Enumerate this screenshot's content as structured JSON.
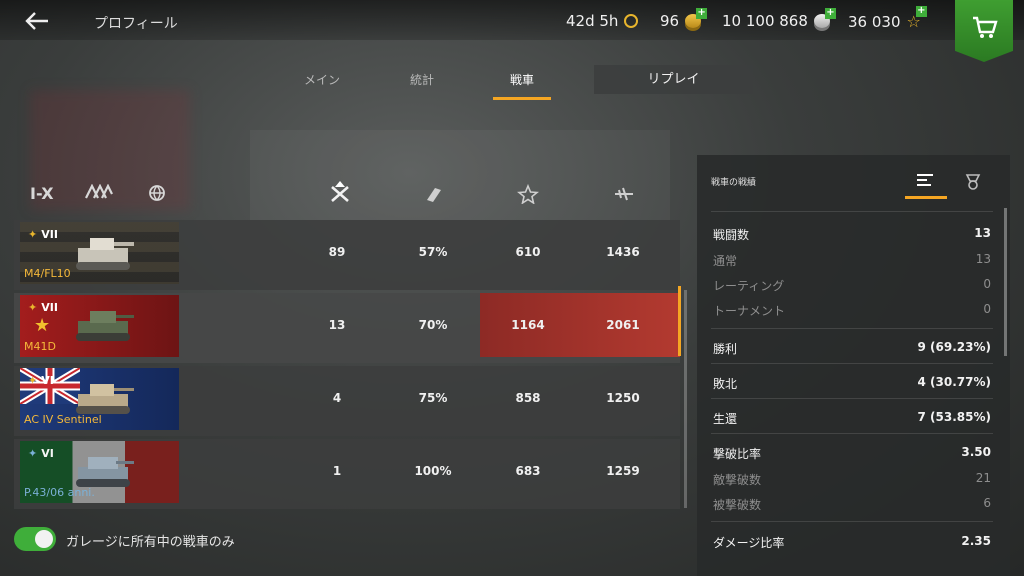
{
  "header": {
    "title": "プロフィール",
    "premium_time": "42d 5h",
    "gold": "96",
    "credits": "10 100 868",
    "free_xp": "36 030"
  },
  "tabs": [
    {
      "label": "メイン",
      "active": false
    },
    {
      "label": "統計",
      "active": false
    },
    {
      "label": "戦車",
      "active": true
    }
  ],
  "replay_button": "リプレイ",
  "filters": {
    "tier": "I-X"
  },
  "tanks": [
    {
      "tier": "VII",
      "name": "M4/FL10",
      "battles": "89",
      "winrate": "57%",
      "avg_xp": "610",
      "avg_damage": "1436",
      "flag": "france",
      "selected": false
    },
    {
      "tier": "VII",
      "name": "M41D",
      "battles": "13",
      "winrate": "70%",
      "avg_xp": "1164",
      "avg_damage": "2061",
      "flag": "china",
      "selected": true
    },
    {
      "tier": "VI",
      "name": "AC IV Sentinel",
      "battles": "4",
      "winrate": "75%",
      "avg_xp": "858",
      "avg_damage": "1250",
      "flag": "uk",
      "selected": false
    },
    {
      "tier": "VI",
      "name": "P.43/06 anni.",
      "battles": "1",
      "winrate": "100%",
      "avg_xp": "683",
      "avg_damage": "1259",
      "flag": "italy",
      "selected": false
    }
  ],
  "toggle": {
    "label": "ガレージに所有中の戦車のみ",
    "on": true
  },
  "panel": {
    "title": "戦車の戦績",
    "stats": [
      {
        "label": "戦闘数",
        "value": "13",
        "type": "main"
      },
      {
        "label": "通常",
        "value": "13",
        "type": "sub"
      },
      {
        "label": "レーティング",
        "value": "0",
        "type": "sub"
      },
      {
        "label": "トーナメント",
        "value": "0",
        "type": "sub"
      },
      {
        "label": "勝利",
        "value": "9 (69.23%)",
        "type": "main"
      },
      {
        "label": "敗北",
        "value": "4 (30.77%)",
        "type": "main"
      },
      {
        "label": "生還",
        "value": "7 (53.85%)",
        "type": "main"
      },
      {
        "label": "撃破比率",
        "value": "3.50",
        "type": "main"
      },
      {
        "label": "敵撃破数",
        "value": "21",
        "type": "sub"
      },
      {
        "label": "被撃破数",
        "value": "6",
        "type": "sub"
      },
      {
        "label": "ダメージ比率",
        "value": "2.35",
        "type": "main"
      }
    ]
  },
  "colors": {
    "accent": "#f5a623",
    "green": "#3fae3a",
    "gold": "#e8b52d",
    "red_highlight": "#b33a30"
  }
}
